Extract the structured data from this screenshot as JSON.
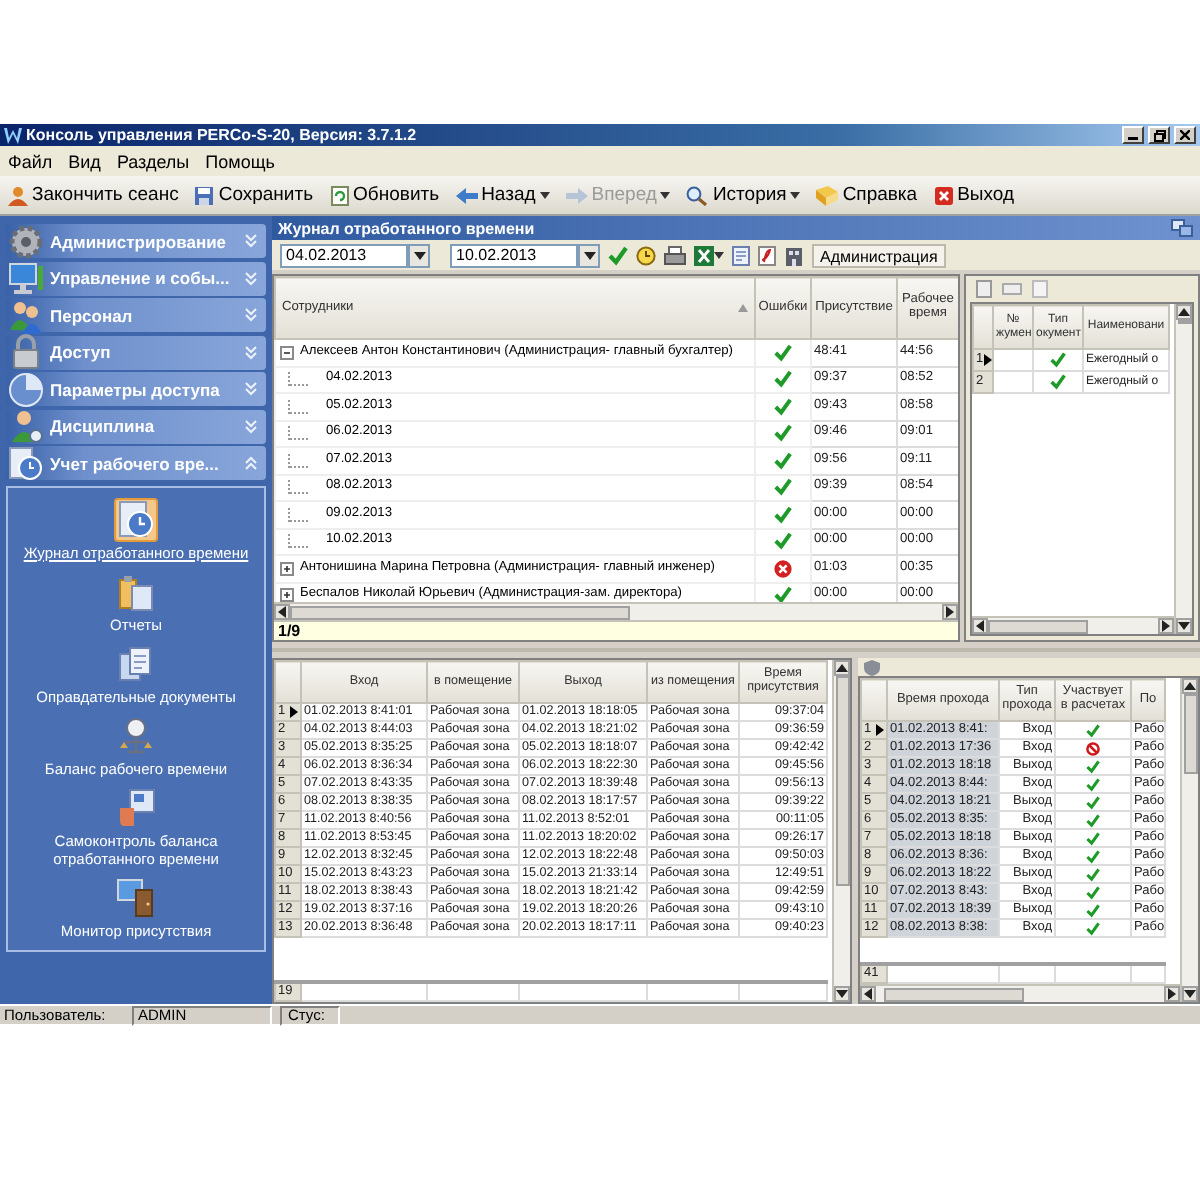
{
  "window": {
    "title": "Консоль управления PERCo-S-20, Версия: 3.7.1.2"
  },
  "menu": [
    "Файл",
    "Вид",
    "Разделы",
    "Помощь"
  ],
  "toolbar": [
    {
      "label": "Закончить сеанс",
      "kind": "button",
      "disabled": false
    },
    {
      "label": "Сохранить",
      "kind": "button",
      "disabled": false
    },
    {
      "label": "Обновить",
      "kind": "button",
      "disabled": false
    },
    {
      "label": "Назад",
      "kind": "menu",
      "disabled": false
    },
    {
      "label": "Вперед",
      "kind": "menu",
      "disabled": true
    },
    {
      "label": "История",
      "kind": "menu",
      "disabled": false
    },
    {
      "label": "Справка",
      "kind": "button",
      "disabled": false
    },
    {
      "label": "Выход",
      "kind": "button",
      "disabled": false
    }
  ],
  "sidebar": {
    "groups": [
      {
        "label": "Администрирование",
        "expanded": false
      },
      {
        "label": "Управление и собы...",
        "expanded": false
      },
      {
        "label": "Персонал",
        "expanded": false
      },
      {
        "label": "Доступ",
        "expanded": false
      },
      {
        "label": "Параметры доступа",
        "expanded": false
      },
      {
        "label": "Дисциплина",
        "expanded": false
      },
      {
        "label": "Учет рабочего вре...",
        "expanded": true,
        "items": [
          {
            "label": "Журнал отработанного времени",
            "selected": true
          },
          {
            "label": "Отчеты",
            "selected": false
          },
          {
            "label": "Оправдательные документы",
            "selected": false
          },
          {
            "label": "Баланс рабочего времени",
            "selected": false
          },
          {
            "label": "Самоконтроль баланса отработанного времени",
            "selected": false
          },
          {
            "label": "Монитор присутствия",
            "selected": false
          }
        ]
      }
    ]
  },
  "journal": {
    "title": "Журнал отработанного времени",
    "date_from": "04.02.2013",
    "date_to": "10.02.2013",
    "department": "Администрация",
    "employees": {
      "columns": [
        "Сотрудники",
        "Ошибки",
        "Присутствие",
        "Рабочее время"
      ],
      "rows": [
        {
          "name": "Алексеев Антон Константинович (Администрация- главный бухгалтер)",
          "has_errors": false,
          "presence": "48:41",
          "work_time": "44:56",
          "expanded": true,
          "children": [
            {
              "name": "04.02.2013",
              "has_errors": false,
              "presence": "09:37",
              "work_time": "08:52"
            },
            {
              "name": "05.02.2013",
              "has_errors": false,
              "presence": "09:43",
              "work_time": "08:58"
            },
            {
              "name": "06.02.2013",
              "has_errors": false,
              "presence": "09:46",
              "work_time": "09:01"
            },
            {
              "name": "07.02.2013",
              "has_errors": false,
              "presence": "09:56",
              "work_time": "09:11"
            },
            {
              "name": "08.02.2013",
              "has_errors": false,
              "presence": "09:39",
              "work_time": "08:54"
            },
            {
              "name": "09.02.2013",
              "has_errors": false,
              "presence": "00:00",
              "work_time": "00:00"
            },
            {
              "name": "10.02.2013",
              "has_errors": false,
              "presence": "00:00",
              "work_time": "00:00"
            }
          ]
        },
        {
          "name": "Антонишина Марина Петровна (Администрация- главный инженер)",
          "has_errors": true,
          "presence": "01:03",
          "work_time": "00:35",
          "expanded": false
        },
        {
          "name": "Беспалов Николай Юрьевич (Администрация-зам. директора)",
          "has_errors": false,
          "presence": "00:00",
          "work_time": "00:00",
          "expanded": false
        }
      ]
    },
    "page": "1/9"
  },
  "documents": {
    "columns": [
      "№ жумен",
      "Тип окумент",
      "Наименовани"
    ],
    "rows": [
      {
        "number": "1",
        "selected": true,
        "checked": true,
        "name": "Ежегодный о"
      },
      {
        "number": "2",
        "selected": false,
        "checked": true,
        "name": "Ежегодный о"
      }
    ]
  },
  "passes": {
    "columns": [
      "Вход",
      "в помещение",
      "Выход",
      "из помещения",
      "Время присутствия"
    ],
    "rows": [
      {
        "number": "1",
        "selected": true,
        "entry": "01.02.2013 8:41:01",
        "entry_zone": "Рабочая зона",
        "exit": "01.02.2013 18:18:05",
        "exit_zone": "Рабочая зона",
        "presence": "09:37:04"
      },
      {
        "number": "2",
        "selected": false,
        "entry": "04.02.2013 8:44:03",
        "entry_zone": "Рабочая зона",
        "exit": "04.02.2013 18:21:02",
        "exit_zone": "Рабочая зона",
        "presence": "09:36:59"
      },
      {
        "number": "3",
        "selected": false,
        "entry": "05.02.2013 8:35:25",
        "entry_zone": "Рабочая зона",
        "exit": "05.02.2013 18:18:07",
        "exit_zone": "Рабочая зона",
        "presence": "09:42:42"
      },
      {
        "number": "4",
        "selected": false,
        "entry": "06.02.2013 8:36:34",
        "entry_zone": "Рабочая зона",
        "exit": "06.02.2013 18:22:30",
        "exit_zone": "Рабочая зона",
        "presence": "09:45:56"
      },
      {
        "number": "5",
        "selected": false,
        "entry": "07.02.2013 8:43:35",
        "entry_zone": "Рабочая зона",
        "exit": "07.02.2013 18:39:48",
        "exit_zone": "Рабочая зона",
        "presence": "09:56:13"
      },
      {
        "number": "6",
        "selected": false,
        "entry": "08.02.2013 8:38:35",
        "entry_zone": "Рабочая зона",
        "exit": "08.02.2013 18:17:57",
        "exit_zone": "Рабочая зона",
        "presence": "09:39:22"
      },
      {
        "number": "7",
        "selected": false,
        "entry": "11.02.2013 8:40:56",
        "entry_zone": "Рабочая зона",
        "exit": "11.02.2013 8:52:01",
        "exit_zone": "Рабочая зона",
        "presence": "00:11:05"
      },
      {
        "number": "8",
        "selected": false,
        "entry": "11.02.2013 8:53:45",
        "entry_zone": "Рабочая зона",
        "exit": "11.02.2013 18:20:02",
        "exit_zone": "Рабочая зона",
        "presence": "09:26:17"
      },
      {
        "number": "9",
        "selected": false,
        "entry": "12.02.2013 8:32:45",
        "entry_zone": "Рабочая зона",
        "exit": "12.02.2013 18:22:48",
        "exit_zone": "Рабочая зона",
        "presence": "09:50:03"
      },
      {
        "number": "10",
        "selected": false,
        "entry": "15.02.2013 8:43:23",
        "entry_zone": "Рабочая зона",
        "exit": "15.02.2013 21:33:14",
        "exit_zone": "Рабочая зона",
        "presence": "12:49:51"
      },
      {
        "number": "11",
        "selected": false,
        "entry": "18.02.2013 8:38:43",
        "entry_zone": "Рабочая зона",
        "exit": "18.02.2013 18:21:42",
        "exit_zone": "Рабочая зона",
        "presence": "09:42:59"
      },
      {
        "number": "12",
        "selected": false,
        "entry": "19.02.2013 8:37:16",
        "entry_zone": "Рабочая зона",
        "exit": "19.02.2013 18:20:26",
        "exit_zone": "Рабочая зона",
        "presence": "09:43:10"
      },
      {
        "number": "13",
        "selected": false,
        "entry": "20.02.2013 8:36:48",
        "entry_zone": "Рабочая зона",
        "exit": "20.02.2013 18:17:11",
        "exit_zone": "Рабочая зона",
        "presence": "09:40:23"
      }
    ],
    "new_row": "19"
  },
  "events": {
    "columns": [
      "Время прохода",
      "Тип прохода",
      "Участвует в расчетах",
      "По"
    ],
    "rows": [
      {
        "number": "1",
        "selected": true,
        "time": "01.02.2013 8:41:",
        "direction": "Вход",
        "counted": true,
        "zone": "Рабо"
      },
      {
        "number": "2",
        "selected": false,
        "time": "01.02.2013 17:36",
        "direction": "Вход",
        "counted": false,
        "zone": "Рабо"
      },
      {
        "number": "3",
        "selected": false,
        "time": "01.02.2013 18:18",
        "direction": "Выход",
        "counted": true,
        "zone": "Рабо"
      },
      {
        "number": "4",
        "selected": false,
        "time": "04.02.2013 8:44:",
        "direction": "Вход",
        "counted": true,
        "zone": "Рабо"
      },
      {
        "number": "5",
        "selected": false,
        "time": "04.02.2013 18:21",
        "direction": "Выход",
        "counted": true,
        "zone": "Рабо"
      },
      {
        "number": "6",
        "selected": false,
        "time": "05.02.2013 8:35:",
        "direction": "Вход",
        "counted": true,
        "zone": "Рабо"
      },
      {
        "number": "7",
        "selected": false,
        "time": "05.02.2013 18:18",
        "direction": "Выход",
        "counted": true,
        "zone": "Рабо"
      },
      {
        "number": "8",
        "selected": false,
        "time": "06.02.2013 8:36:",
        "direction": "Вход",
        "counted": true,
        "zone": "Рабо"
      },
      {
        "number": "9",
        "selected": false,
        "time": "06.02.2013 18:22",
        "direction": "Выход",
        "counted": true,
        "zone": "Рабо"
      },
      {
        "number": "10",
        "selected": false,
        "time": "07.02.2013 8:43:",
        "direction": "Вход",
        "counted": true,
        "zone": "Рабо"
      },
      {
        "number": "11",
        "selected": false,
        "time": "07.02.2013 18:39",
        "direction": "Выход",
        "counted": true,
        "zone": "Рабо"
      },
      {
        "number": "12",
        "selected": false,
        "time": "08.02.2013 8:38:",
        "direction": "Вход",
        "counted": true,
        "zone": "Рабо"
      }
    ],
    "new_row": "41"
  },
  "status_bar": {
    "user_label": "Пользователь:",
    "user": "ADMIN",
    "status_label": "Стус:"
  }
}
